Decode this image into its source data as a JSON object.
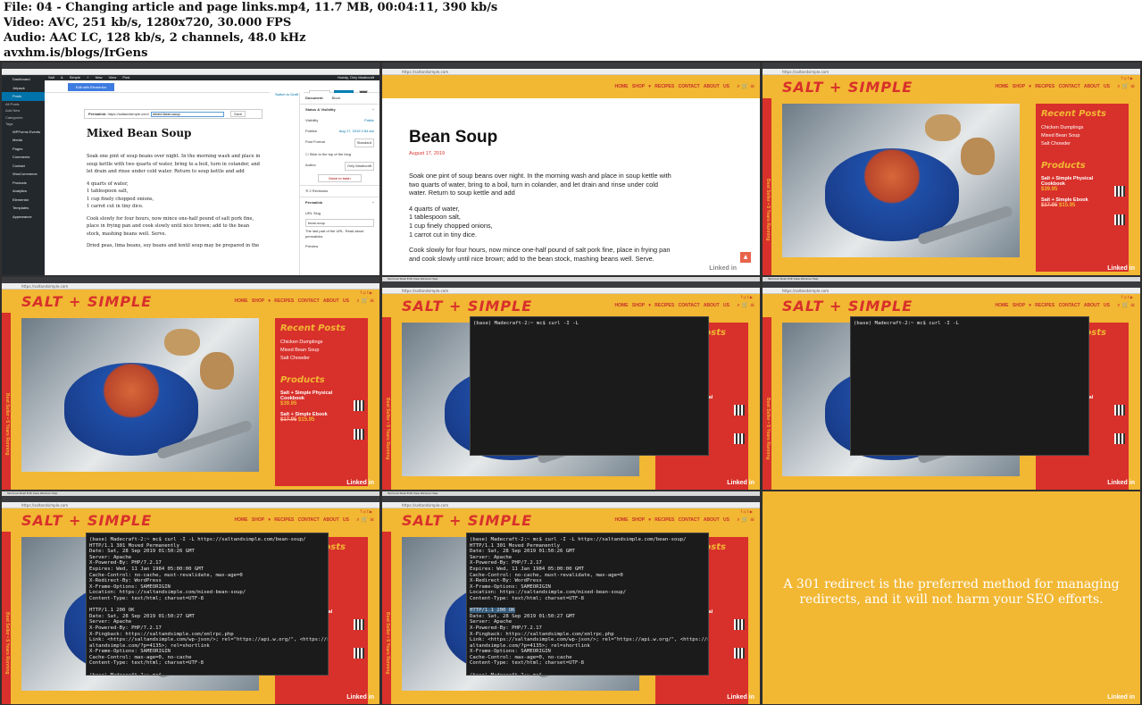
{
  "header": {
    "file_line": "File: 04 - Changing article and page links.mp4, 11.7 MB, 00:04:11, 390 kb/s",
    "video_line": "Video: AVC, 251 kb/s, 1280x720, 30.000 FPS",
    "audio_line": "Audio: AAC LC, 128 kb/s, 2 channels, 48.0 kHz",
    "site_line": "avxhm.is/blogs/IrGens"
  },
  "site": {
    "logo": "SALT + SIMPLE",
    "menu": "HOME  SHOP ▾  RECIPES  CONTACT  ABOUT US",
    "vertical_text": "Best Seller • 5 Years Running",
    "sidebar_recent_title": "Recent Posts",
    "recent_posts": [
      "Chicken Dumplings",
      "Mixed Bean Soup",
      "Salt Chowder"
    ],
    "products_title": "Products",
    "product1_name": "Salt + Simple Physical Cookbook",
    "product1_price": "$39.95",
    "product2_name": "Salt + Simple Ebook",
    "product2_old_price": "$17.95",
    "product2_price": "$15.95",
    "linkedin": "Linked in",
    "url": "https://saltandsimple.com"
  },
  "wp": {
    "sidebar": [
      "Dashboard",
      "Jetpack",
      "Posts",
      "All Posts",
      "Add New",
      "Categories",
      "Tags",
      "WPForms Events",
      "Media",
      "Pages",
      "Comments",
      "Contact",
      "WooCommerce",
      "Products",
      "Analytics",
      "Elementor",
      "Templates",
      "Appearance"
    ],
    "topbar": "Salt & Simple  +  New  View Post",
    "howdy": "Howdy, Only Madecraft",
    "edit_elementor": "Edit with Elementor",
    "switch_draft": "Switch to Draft",
    "preview": "Preview",
    "update": "Update",
    "permalink_label": "Permalink:",
    "permalink_base": "https://saltandsimple.com/",
    "permalink_slug": "mixed-bean-soup",
    "save": "Save",
    "post_title": "Mixed Bean Soup",
    "body_p1": "Soak one pint of soup beans over night. In the morning wash and place in soup kettle with two quarts of water, bring to a boil, turn in colander, and let drain and rinse under cold water. Return to soup kettle and add",
    "body_p2_lines": [
      "4 quarts of water,",
      "1 tablespoon salt,",
      "1 cup finely chopped onions,",
      "1 carrot cut in tiny dice."
    ],
    "body_p3": "Cook slowly for four hours, now mince one-half pound of salt pork fine, place in frying pan and cook slowly until nice brown; add to the bean stock, mashing beans well. Serve.",
    "body_p4": "Dried peas, lima beans, soy beans and lentil soup may be prepared in the",
    "panel_tabs": [
      "Document",
      "Block"
    ],
    "status_visibility": "Status & Visibility",
    "visibility_label": "Visibility",
    "visibility_value": "Public",
    "publish_label": "Publish",
    "publish_value": "Aug 17, 2019 2:54 am",
    "format_label": "Post Format",
    "format_value": "Standard",
    "stick_label": "Stick to the top of the blog",
    "author_label": "Author",
    "author_value": "Only Madecraft",
    "trash": "Move to trash",
    "revisions": "2 Revisions",
    "permalink_section": "Permalink",
    "url_slug_label": "URL Slug",
    "url_slug_value": "bean-soup",
    "slug_help": "The last part of the URL. Read about permalinks",
    "preview_label": "Preview"
  },
  "post": {
    "title": "Bean Soup",
    "date": "August 17, 2019",
    "p1": "Soak one pint of soup beans over night. In the morning wash and place in soup kettle with two quarts of water, bring to a boil, turn in colander, and let drain and rinse under cold water. Return to soup kettle and add",
    "p2_lines": [
      "4 quarts of water,",
      "1 tablespoon salt,",
      "1 cup finely chopped onions,",
      "1 carrot cut in tiny dice."
    ],
    "p3": "Cook slowly for four hours, now mince one-half pound of salt pork fine, place in frying pan and cook slowly until nice brown; add to the bean stock, mashing beans well. Serve."
  },
  "terminal": {
    "prompt_cmd": "(base) Madecraft-2:~ mc$ curl -I -L",
    "command": "(base) Madecraft-2:~ mc$ curl -I -L https://saltandsimple.com/bean-soup/",
    "lines1": [
      "HTTP/1.1 301 Moved Permanently",
      "Date: Sat, 28 Sep 2019 01:50:26 GMT",
      "Server: Apache",
      "X-Powered-By: PHP/7.2.17",
      "Expires: Wed, 11 Jan 1984 05:00:00 GMT",
      "Cache-Control: no-cache, must-revalidate, max-age=0",
      "X-Redirect-By: WordPress",
      "X-Frame-Options: SAMEORIGIN",
      "Location: https://saltandsimple.com/mixed-bean-soup/",
      "Content-Type: text/html; charset=UTF-8"
    ],
    "status200": "HTTP/1.1 200 OK",
    "lines2": [
      "Date: Sat, 28 Sep 2019 01:50:27 GMT",
      "Server: Apache",
      "X-Powered-By: PHP/7.2.17",
      "X-Pingback: https://saltandsimple.com/xmlrpc.php",
      "Link: <https://saltandsimple.com/wp-json/>; rel=\"https://api.w.org/\", <https://s",
      "altandsimple.com/?p=4135>; rel=shortlink",
      "X-Frame-Options: SAMEORIGIN",
      "Cache-Control: max-age=0, no-cache",
      "Content-Type: text/html; charset=UTF-8"
    ],
    "final_prompt": "(base) Madecraft-2:~ mc$"
  },
  "caption": "A 301 redirect is the preferred method for managing redirects, and it will not harm your SEO efforts.",
  "colors": {
    "yellow": "#f2b733",
    "red": "#d8302b",
    "wp_dark": "#23282d",
    "wp_blue": "#0085ba"
  }
}
